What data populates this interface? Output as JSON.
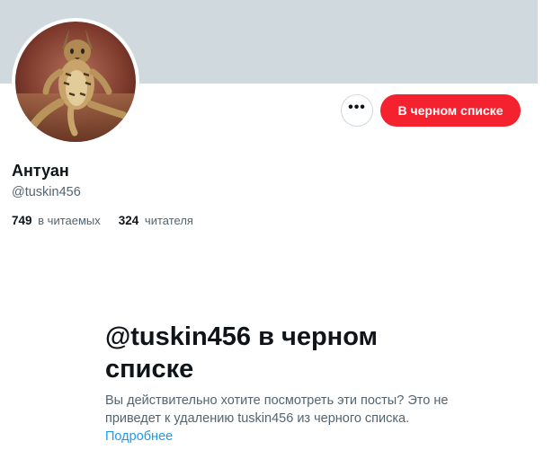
{
  "profile": {
    "display_name": "Антуан",
    "handle": "@tuskin456",
    "following_count": "749",
    "following_label": "в читаемых",
    "followers_count": "324",
    "followers_label": "читателя"
  },
  "actions": {
    "more_label": "•••",
    "blocked_button_label": "В черном списке"
  },
  "blocked_notice": {
    "title": "@tuskin456 в черном списке",
    "body": "Вы действительно хотите посмотреть эти посты? Это не приведет к удалению tuskin456 из черного списка. ",
    "link_label": "Подробнее"
  },
  "colors": {
    "banner": "#cfd9de",
    "danger": "#f4212e",
    "link": "#1d9bf0",
    "secondary_text": "#536471"
  },
  "icons": {
    "avatar": "cat-photo"
  }
}
